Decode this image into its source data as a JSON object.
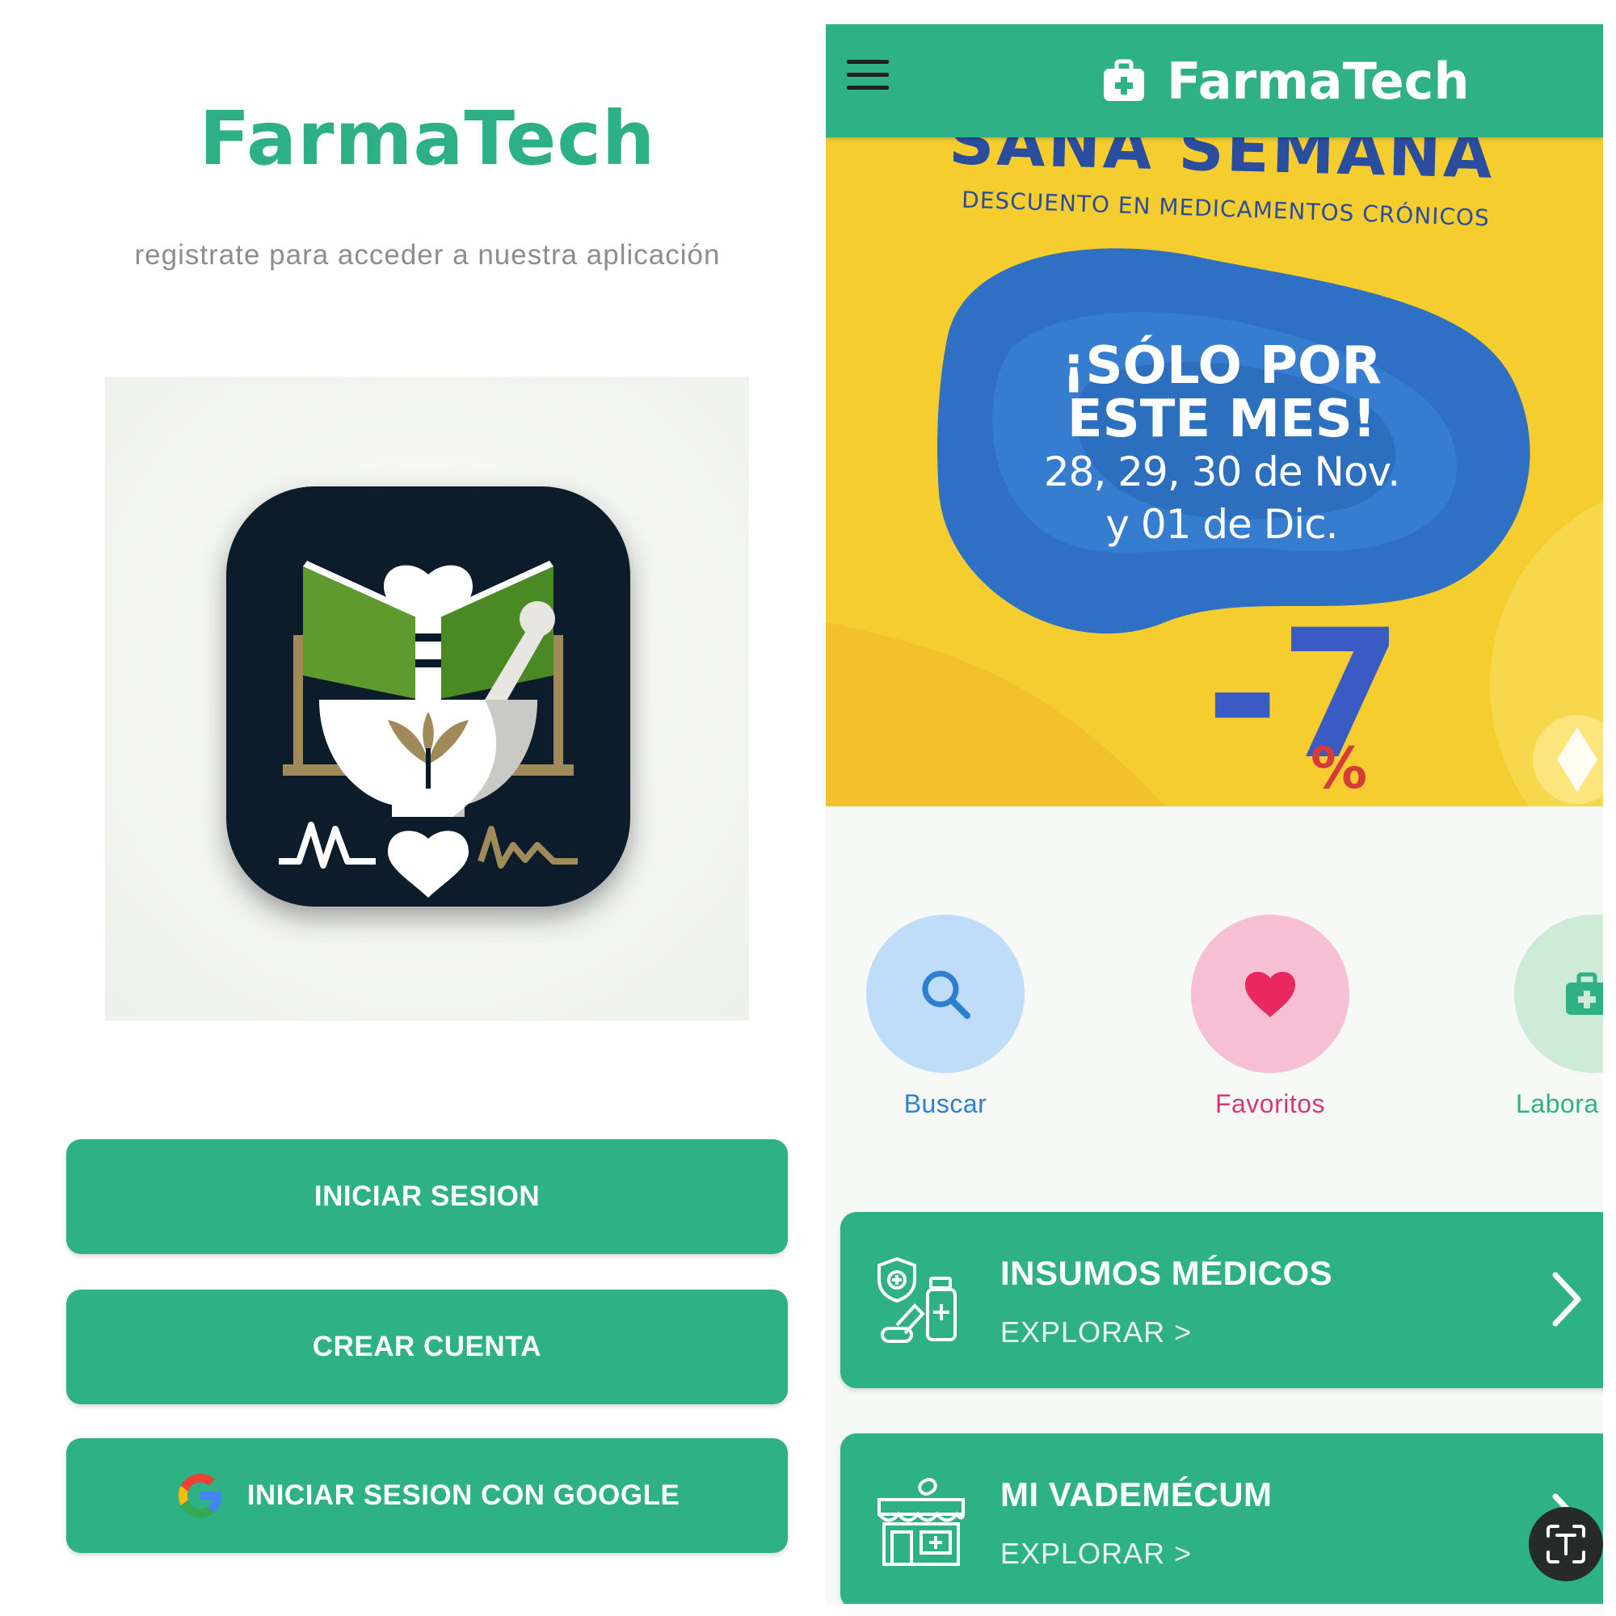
{
  "login": {
    "app_title": "FarmaTech",
    "subtitle": "registrate para acceder a nuestra aplicación",
    "logo_icon": "pharmacy-mortar-book-heart-logo",
    "buttons": {
      "login": "INICIAR SESION",
      "create_account": "CREAR CUENTA",
      "google_login": "INICIAR SESION CON GOOGLE"
    },
    "google_icon": "google-g-icon"
  },
  "home": {
    "app_bar": {
      "menu_icon": "hamburger-menu-icon",
      "brand_icon": "medical-kit-icon",
      "title": "FarmaTech"
    },
    "promo": {
      "headline": "SANA SEMANA",
      "subheadline": "DESCUENTO EN MEDICAMENTOS CRÓNICOS",
      "line1": "¡SÓLO POR ESTE MES!",
      "date_line1": "28, 29, 30 de Nov.",
      "date_line2": "y 01 de Dic.",
      "discount": "-7",
      "percent": "%"
    },
    "shortcuts": [
      {
        "label": "Buscar",
        "icon": "search-icon"
      },
      {
        "label": "Favoritos",
        "icon": "heart-icon"
      },
      {
        "label": "Labora",
        "icon": "medical-kit-icon"
      }
    ],
    "categories": [
      {
        "title": "INSUMOS MÉDICOS",
        "link": "EXPLORAR >",
        "icon": "medical-supplies-icon"
      },
      {
        "title": "MI VADEMÉCUM",
        "link": "EXPLORAR >",
        "icon": "pharmacy-store-icon"
      }
    ],
    "colors": {
      "primary": "#2eb185",
      "banner_yellow": "#f5cb2c",
      "banner_blue": "#2f6fc4",
      "search_accent": "#2d7fd1",
      "favorites_accent": "#e8285f"
    }
  }
}
